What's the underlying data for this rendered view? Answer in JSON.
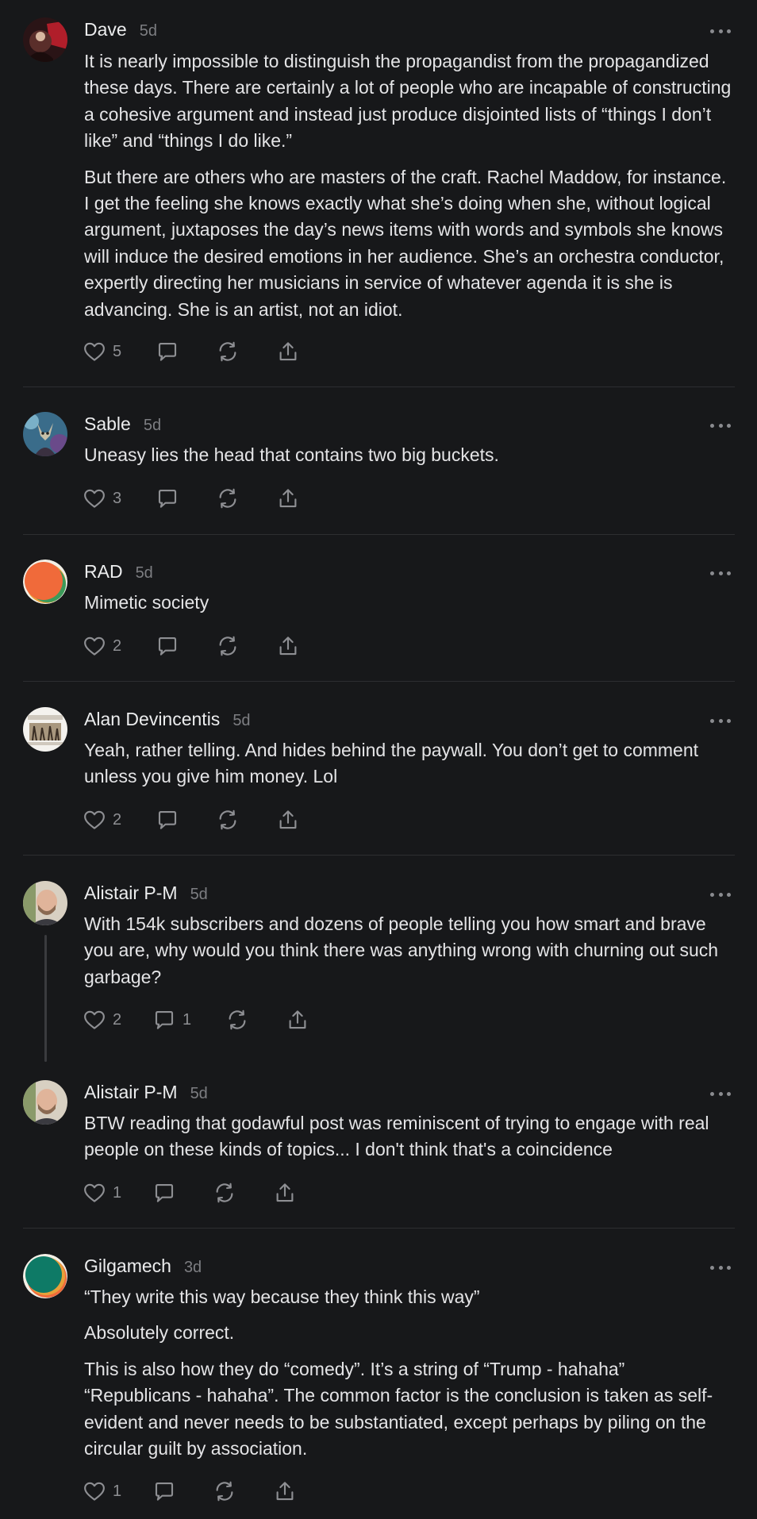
{
  "comments": [
    {
      "author": "Dave",
      "time": "5d",
      "paragraphs": [
        "It is nearly impossible to distinguish the propagandist from the propagandized these days. There are certainly a lot of people who are incapable of constructing a cohesive argument and instead just produce disjointed lists of “things I don’t like” and “things I do like.”",
        "But there are others who are masters of the craft. Rachel Maddow, for instance. I get the feeling she knows exactly what she’s doing when she, without logical argument, juxtaposes the day’s news items with words and symbols she knows will induce the desired emotions in her audience. She’s an orchestra conductor, expertly directing her musicians in service of whatever agenda it is she is advancing. She is an artist, not an idiot."
      ],
      "likes": "5",
      "replies": ""
    },
    {
      "author": "Sable",
      "time": "5d",
      "paragraphs": [
        "Uneasy lies the head that contains two big buckets."
      ],
      "likes": "3",
      "replies": ""
    },
    {
      "author": "RAD",
      "time": "5d",
      "paragraphs": [
        "Mimetic society"
      ],
      "likes": "2",
      "replies": ""
    },
    {
      "author": "Alan Devincentis",
      "time": "5d",
      "paragraphs": [
        "Yeah, rather telling. And hides behind the paywall. You don’t get to comment unless you give him money. Lol"
      ],
      "likes": "2",
      "replies": ""
    },
    {
      "author": "Alistair P-M",
      "time": "5d",
      "paragraphs": [
        "With 154k subscribers and dozens of people telling you how smart and brave you are, why would you think there was anything wrong with churning out such garbage?"
      ],
      "likes": "2",
      "replies": "1"
    },
    {
      "author": "Alistair P-M",
      "time": "5d",
      "paragraphs": [
        "BTW reading that godawful post was reminiscent of trying to engage with real people on these kinds of topics... I don't think that's a coincidence"
      ],
      "likes": "1",
      "replies": ""
    },
    {
      "author": "Gilgamech",
      "time": "3d",
      "paragraphs": [
        "“They write this way because they think this way”",
        "Absolutely correct.",
        "This is also how they do “comedy”. It’s a string of “Trump - hahaha” “Republicans - hahaha”. The common factor is the conclusion is taken as self-evident and never needs to be substantiated, except perhaps by piling on the circular guilt by association."
      ],
      "likes": "1",
      "replies": ""
    }
  ],
  "icons": {
    "like": "heart-icon",
    "reply": "comment-icon",
    "restack": "restack-icon",
    "share": "share-icon",
    "more": "more-options-icon"
  },
  "colors": {
    "background": "#17181a",
    "text": "#e4e4e6",
    "muted": "#8e8f93",
    "divider": "#2d2e31"
  }
}
